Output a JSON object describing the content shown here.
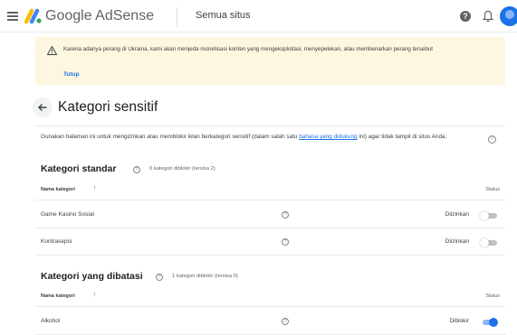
{
  "colors": {
    "accent": "#1a73e8",
    "banner_bg": "#fef7e0",
    "warning": "#f9ab00"
  },
  "header": {
    "brand": "Google AdSense",
    "site_selector": "Semua situs",
    "help_glyph": "?",
    "icons": [
      "menu-icon",
      "adsense-logo",
      "help-icon",
      "bell-icon",
      "avatar"
    ]
  },
  "banner": {
    "text": "Karena adanya perang di Ukraina, kami akan menjeda monetisasi konten yang mengeksploitasi, menyepelekan, atau membenarkan perang tersebut",
    "dismiss_label": "Tutup"
  },
  "page": {
    "title": "Kategori sensitif",
    "description_before": "Gunakan halaman ini untuk mengizinkan atau memblokir iklan berkategori sensitif (dalam salah satu ",
    "description_link": "bahasa yang didukung",
    "description_after": " ini) agar tidak tampil di situs Anda."
  },
  "standard": {
    "title": "Kategori standar",
    "count_text": "0 kategori diblokir (tersisa 2)",
    "header_name": "Nama kategori",
    "header_sort_glyph": "↑",
    "header_status": "Status",
    "rows": [
      {
        "name": "Game Kasino Sosial",
        "status": "Diizinkan",
        "enabled": false
      },
      {
        "name": "Kontrasepsi",
        "status": "Diizinkan",
        "enabled": false
      }
    ]
  },
  "restricted": {
    "title": "Kategori yang dibatasi",
    "count_text": "1 kategori diblokir (tersisa 0)",
    "header_name": "Nama kategori",
    "header_sort_glyph": "↑",
    "header_status": "Status",
    "rows": [
      {
        "name": "Alkohol",
        "status": "Diblokir",
        "enabled": true
      }
    ]
  }
}
